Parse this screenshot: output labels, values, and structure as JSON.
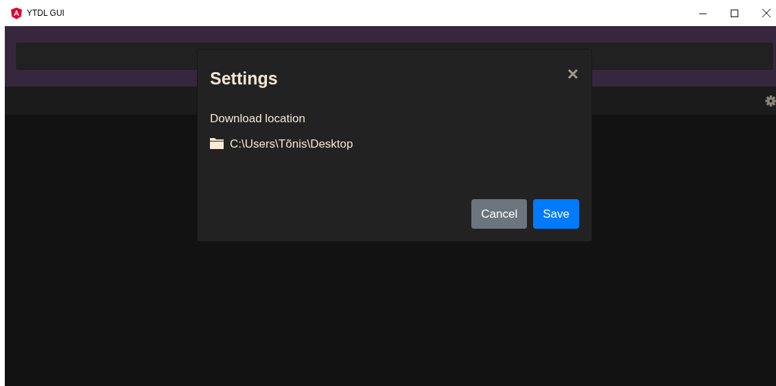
{
  "window": {
    "title": "YTDL GUI"
  },
  "dialog": {
    "title": "Settings",
    "close": "×",
    "field_label": "Download location",
    "path": "C:\\Users\\Tõnis\\Desktop",
    "buttons": [
      {
        "label": "Cancel",
        "kind": "secondary"
      },
      {
        "label": "Save",
        "kind": "primary"
      }
    ]
  }
}
